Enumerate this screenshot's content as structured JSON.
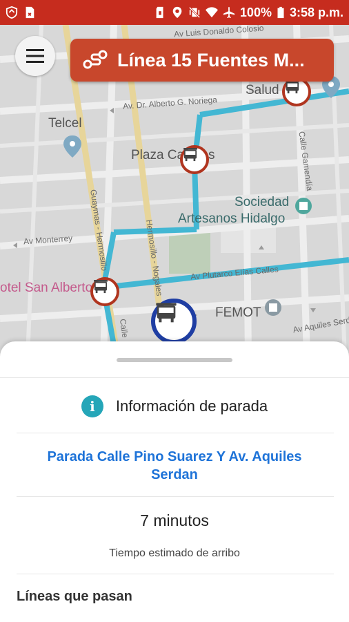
{
  "status_bar": {
    "battery": "100%",
    "time": "3:58 p.m.",
    "icons": [
      "shield-icon",
      "sim-icon",
      "sd-card-icon",
      "location-icon",
      "vibrate-icon",
      "wifi-icon",
      "airplane-icon",
      "battery-icon"
    ]
  },
  "map": {
    "streets": {
      "luis_donaldo_colosio": "Av Luis Donaldo Colosio",
      "alberto_noriega": "Av. Dr. Alberto G. Noriega",
      "monterrey": "Av Monterrey",
      "plutarco": "Av Plutarco Elías Calles",
      "aquiles": "Av Aquiles Serdán",
      "guaymas": "Guaymas - Hermosillo",
      "hermosillo": "Hermosillo - Nogales",
      "gamendia": "Calle Gamendía",
      "calle": "Calle"
    },
    "places": {
      "telcel": "Telcel",
      "salud": "Salud",
      "plaza": "Plaza Ca",
      "plaza_end": "s",
      "sociedad": "Sociedad",
      "artesanos": "Artesanos Hidalgo",
      "hotel": "otel San Alberto",
      "femot": "FEMOT"
    }
  },
  "route": {
    "label": "Línea 15 Fuentes M...",
    "icon": "route-icon"
  },
  "sheet": {
    "header": "Información de parada",
    "stop_name": "Parada Calle Pino Suarez Y Av. Aquiles Serdan",
    "eta_value": "7 minutos",
    "eta_label": "Tiempo estimado de arribo",
    "lines_title": "Líneas que pasan"
  },
  "colors": {
    "status_bar": "#c62c1e",
    "route_button": "#c8472c",
    "route_line": "#43b7d3",
    "stop_ring": "#b0351f",
    "selected_stop_ring": "#1f3ea3",
    "info_icon": "#25a6b8",
    "stop_name": "#1e73d8"
  }
}
